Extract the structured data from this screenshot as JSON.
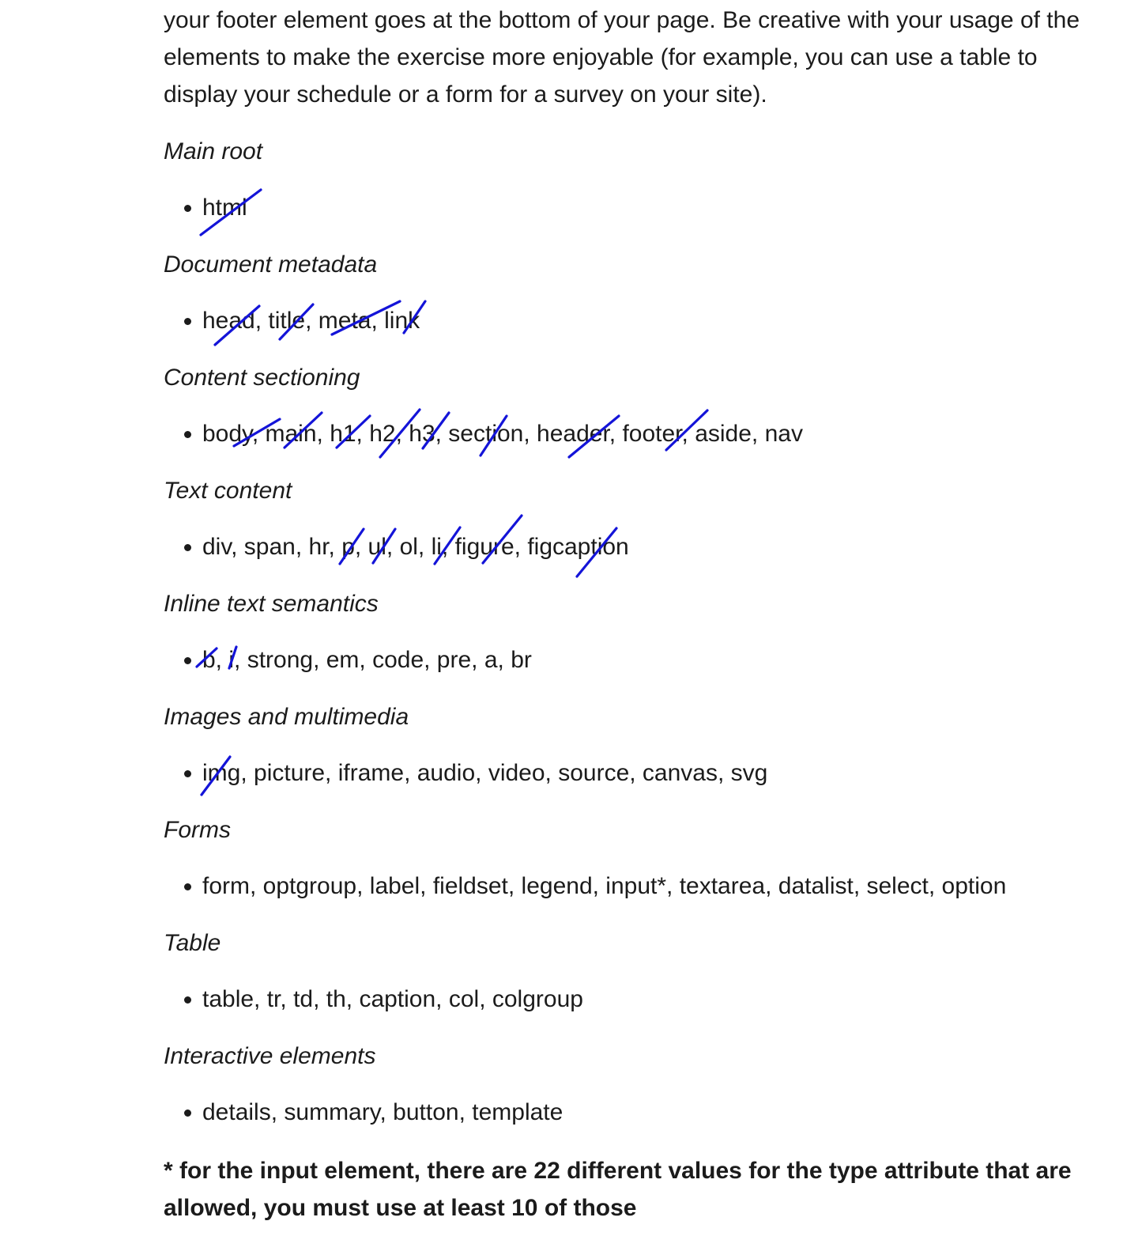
{
  "intro": {
    "lines": [
      "your footer element goes at the bottom of your page. Be creative with your usage of the",
      "elements to make the exercise more enjoyable (for example, you can use a table to",
      "display your schedule or a form for a survey on your site)."
    ]
  },
  "sections": [
    {
      "heading": "Main root",
      "items": "html"
    },
    {
      "heading": "Document metadata",
      "items": "head, title, meta, link"
    },
    {
      "heading": "Content sectioning",
      "items": "body, main, h1, h2, h3, section, header, footer, aside, nav"
    },
    {
      "heading": "Text content",
      "items": "div, span, hr, p, ul, ol, li, figure, figcaption"
    },
    {
      "heading": "Inline text semantics",
      "items": "b, i, strong, em, code, pre, a, br"
    },
    {
      "heading": "Images and multimedia",
      "items": "img, picture, iframe, audio, video, source, canvas, svg"
    },
    {
      "heading": "Forms",
      "items": "form, optgroup, label, fieldset, legend, input*, textarea, datalist, select, option"
    },
    {
      "heading": "Table",
      "items": "table, tr, td, th, caption, col, colgroup"
    },
    {
      "heading": "Interactive elements",
      "items": "details, summary, button, template"
    }
  ],
  "note": {
    "lines": [
      "* for the input element, there are 22 different values for the type attribute that are",
      "allowed, you must use at least 10 of those"
    ]
  },
  "annotations": {
    "pen_color": "#1414d8",
    "checked_items": [
      "html",
      "head",
      "title",
      "meta",
      "link",
      "body",
      "main",
      "h1",
      "h2",
      "h3",
      "section",
      "header",
      "footer",
      "p",
      "ul",
      "li",
      "figure",
      "figcaption",
      "b",
      "i",
      "img"
    ]
  }
}
